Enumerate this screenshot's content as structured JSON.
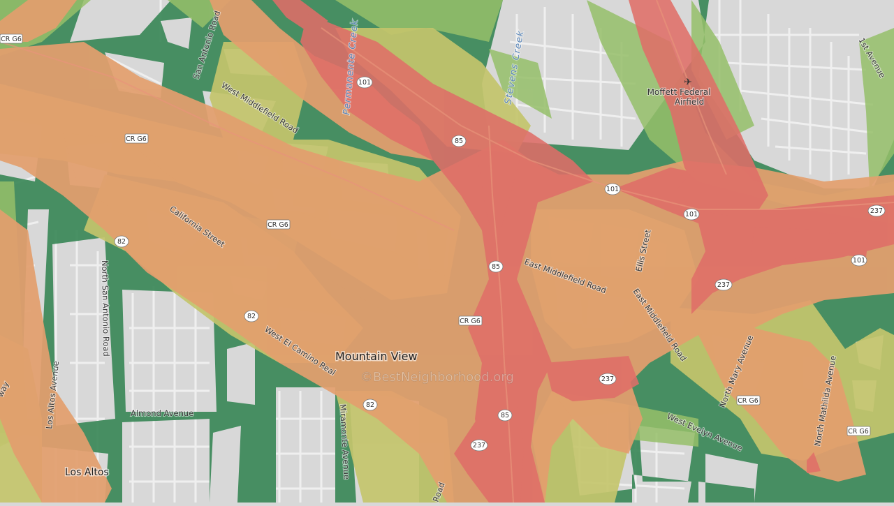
{
  "map": {
    "colors": {
      "base": "#d8d8d8",
      "street": "#f4f4f4",
      "green": "#3f8a5c",
      "lightgreen": "#96c06a",
      "yellow": "#c4c56c",
      "orange": "#e39f6e",
      "red": "#df6e68"
    },
    "watermark": "©BestNeighborhood.org",
    "places": {
      "mountain_view": "Mountain View",
      "los_altos": "Los Altos",
      "moffett_line1": "Moffett Federal",
      "moffett_line2": "Airfield",
      "airport_icon": "airport-icon"
    },
    "water": {
      "permanente": "Permanente Creek",
      "stevens": "Stevens Creek"
    },
    "roads": {
      "san_antonio": "San Antonio Road",
      "west_middlefield": "West Middlefield Road",
      "california": "California Street",
      "north_san_antonio": "North San Antonio Road",
      "los_altos_ave": "Los Altos Avenue",
      "almond": "Almond Avenue",
      "west_el_camino": "West El Camino Real",
      "miramonte": "Miramonte Avenue",
      "east_middlefield_1": "East Middlefield Road",
      "east_middlefield_2": "East Middlefield Road",
      "ellis": "Ellis Street",
      "north_mary": "North Mary Avenue",
      "north_mathilda": "North Mathilda Avenue",
      "west_evelyn": "West Evelyn Avenue",
      "first_ave": "1st Avenue",
      "road_partial": "Road",
      "way_partial": "way"
    },
    "shields": {
      "cr_g6": "CR G6",
      "r101": "101",
      "r85": "85",
      "r82": "82",
      "r237": "237"
    }
  }
}
